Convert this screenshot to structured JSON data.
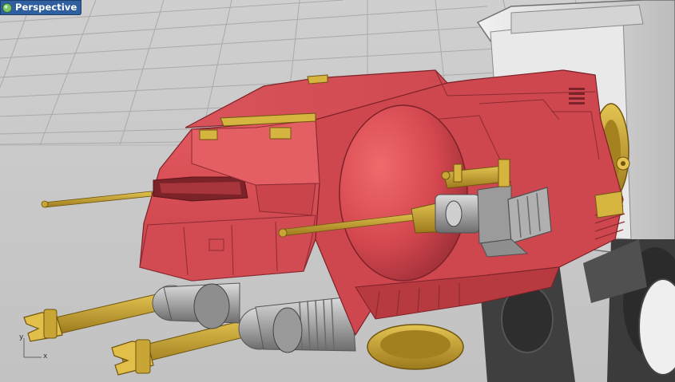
{
  "viewport": {
    "label": "Perspective",
    "icon": "viewport-sphere-icon",
    "tab_color": "#2f5f9e"
  },
  "axes": {
    "x_label": "x",
    "y_label": "y"
  },
  "colors": {
    "hull": "#d85158",
    "hull_shadow": "#9e3038",
    "hull_light": "#ec6e70",
    "brass": "#b89327",
    "brass_light": "#e0c04a",
    "metal": "#a7a7a7",
    "metal_dark": "#5f5f5f",
    "background": "#c8c8c8",
    "grid_line": "#a9a9a9"
  }
}
